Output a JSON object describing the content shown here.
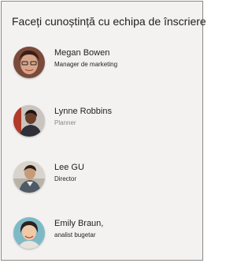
{
  "panel": {
    "title": "Faceți cunoștință cu echipa de înscriere"
  },
  "people": [
    {
      "name": "Megan Bowen",
      "role": "Manager de marketing"
    },
    {
      "name": "Lynne Robbins",
      "role": "Planner"
    },
    {
      "name": "Lee GU",
      "role": "Director"
    },
    {
      "name": "Emily Braun,",
      "role": "analist bugetar"
    }
  ],
  "colors": {
    "panel_background": "#f3f2f1",
    "border": "#8a8886",
    "text": "#201f1e",
    "muted_text": "#8a8886"
  }
}
